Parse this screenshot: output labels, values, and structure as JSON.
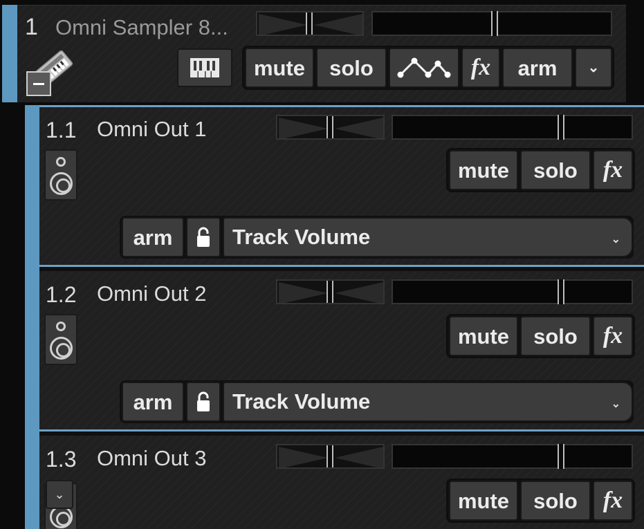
{
  "parent_track": {
    "number": "1",
    "name": "Omni Sampler 8...",
    "buttons": {
      "mute": "mute",
      "solo": "solo",
      "fx": "fx",
      "arm": "arm",
      "menu_chevron": "⌄"
    },
    "instrument_icon": "keyboard-icon",
    "collapse_icon": "minus-icon"
  },
  "child_tracks": [
    {
      "number": "1.1",
      "name": "Omni Out 1",
      "buttons": {
        "mute": "mute",
        "solo": "solo",
        "fx": "fx"
      },
      "automation": {
        "arm": "arm",
        "parameter": "Track Volume",
        "chevron": "⌄"
      }
    },
    {
      "number": "1.2",
      "name": "Omni Out 2",
      "buttons": {
        "mute": "mute",
        "solo": "solo",
        "fx": "fx"
      },
      "automation": {
        "arm": "arm",
        "parameter": "Track Volume",
        "chevron": "⌄"
      }
    },
    {
      "number": "1.3",
      "name": "Omni Out 3",
      "buttons": {
        "mute": "mute",
        "solo": "solo",
        "fx": "fx"
      },
      "expand_chevron": "⌄"
    }
  ],
  "colors": {
    "track_color": "#5d98c1",
    "button_bg": "#3c3c3c",
    "panel_bg": "#202020"
  }
}
